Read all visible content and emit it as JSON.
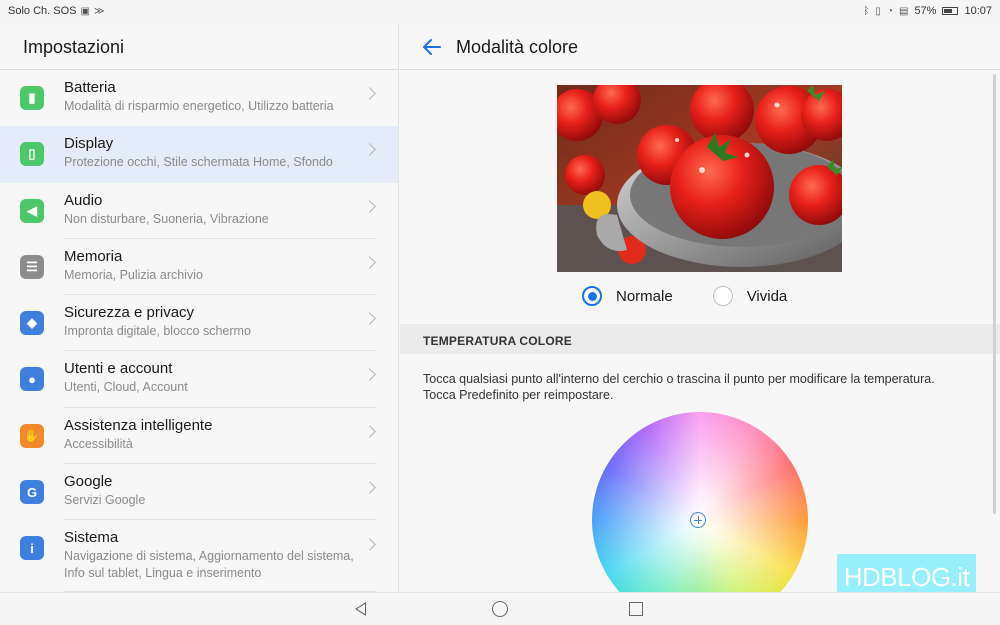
{
  "status_bar": {
    "carrier": "Solo Ch. SOS",
    "battery": "57%",
    "time": "10:07",
    "icons": [
      "sim-icon",
      "signal-icon",
      "bluetooth-icon",
      "vibrate-icon",
      "wifi-icon",
      "sim-card-icon",
      "battery-icon"
    ]
  },
  "settings": {
    "title": "Impostazioni",
    "items": [
      {
        "title": "Batteria",
        "subtitle": "Modalità di risparmio energetico, Utilizzo batteria",
        "icon": "battery-icon",
        "color": "#4cc76a",
        "glyph": "▮"
      },
      {
        "title": "Display",
        "subtitle": "Protezione occhi, Stile schermata Home, Sfondo",
        "icon": "display-icon",
        "color": "#4cc76a",
        "glyph": "▯"
      },
      {
        "title": "Audio",
        "subtitle": "Non disturbare, Suoneria, Vibrazione",
        "icon": "speaker-icon",
        "color": "#4cc76a",
        "glyph": "◀"
      },
      {
        "title": "Memoria",
        "subtitle": "Memoria, Pulizia archivio",
        "icon": "storage-icon",
        "color": "#8c8c8c",
        "glyph": "☰"
      },
      {
        "title": "Sicurezza e privacy",
        "subtitle": "Impronta digitale, blocco schermo",
        "icon": "shield-icon",
        "color": "#3f7fe0",
        "glyph": "◆"
      },
      {
        "title": "Utenti e account",
        "subtitle": "Utenti, Cloud, Account",
        "icon": "user-icon",
        "color": "#3f7fe0",
        "glyph": "●"
      },
      {
        "title": "Assistenza intelligente",
        "subtitle": "Accessibilità",
        "icon": "hand-icon",
        "color": "#f08a2c",
        "glyph": "✋"
      },
      {
        "title": "Google",
        "subtitle": "Servizi Google",
        "icon": "google-icon",
        "color": "#3f7fe0",
        "glyph": "G"
      },
      {
        "title": "Sistema",
        "subtitle": "Navigazione di sistema, Aggiornamento del sistema, Info sul tablet, Lingua e inserimento",
        "icon": "info-icon",
        "color": "#3f7fe0",
        "glyph": "i"
      }
    ],
    "active_index": 1
  },
  "color_mode": {
    "title": "Modalità colore",
    "preview_icon": "tomatoes-colander-photo",
    "options": [
      {
        "label": "Normale",
        "checked": true
      },
      {
        "label": "Vivida",
        "checked": false
      }
    ],
    "section_header": "TEMPERATURA COLORE",
    "description_1": "Tocca qualsiasi punto all'interno del cerchio o trascina il punto per modificare la temperatura.",
    "description_2": "Tocca Predefinito per reimpostare.",
    "accent_color": "#1a73e8"
  },
  "watermark": {
    "text": "HDBLOG.it"
  },
  "nav_bar": {
    "icons": [
      "nav-back-icon",
      "nav-home-icon",
      "nav-recents-icon"
    ]
  }
}
